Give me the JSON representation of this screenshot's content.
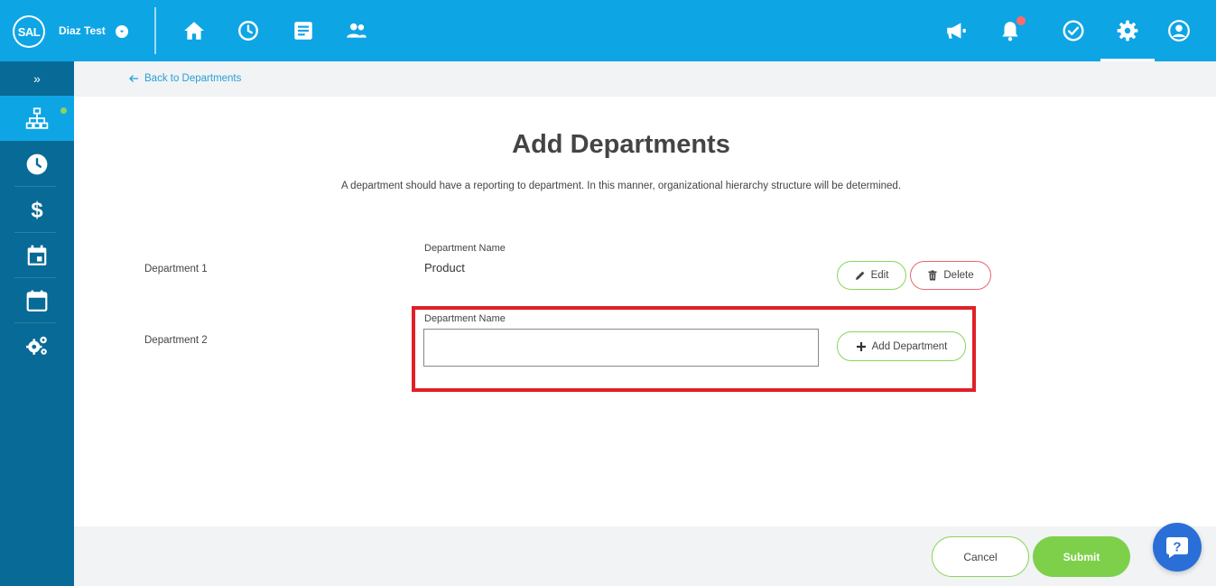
{
  "header": {
    "logo_text": "SAL",
    "company_name": "Diaz Test",
    "icons": [
      "home-icon",
      "clock-icon",
      "document-icon",
      "people-icon",
      "megaphone-icon",
      "bell-icon",
      "check-circle-icon",
      "gear-icon",
      "user-icon"
    ]
  },
  "sidebar": {
    "expand_label": "»",
    "items": [
      "org-chart-icon",
      "clock-icon",
      "dollar-icon",
      "calendar-icon",
      "calendar-blank-icon",
      "gears-icon"
    ]
  },
  "breadcrumb": {
    "back_label": "Back to Departments"
  },
  "page": {
    "title": "Add Departments",
    "subtitle": "A department should have a reporting to department. In this manner, organizational hierarchy structure will be determined."
  },
  "departments": [
    {
      "label": "Department 1",
      "field_label": "Department Name",
      "value": "Product",
      "edit_label": "Edit",
      "delete_label": "Delete"
    },
    {
      "label": "Department 2",
      "field_label": "Department Name",
      "input_value": "",
      "add_label": "Add Department"
    }
  ],
  "footer": {
    "cancel_label": "Cancel",
    "submit_label": "Submit"
  },
  "colors": {
    "primary": "#0ea5e5",
    "sidebar": "#086a96",
    "accent_green": "#7ed04b",
    "danger": "#e5666f",
    "highlight": "#e02127"
  }
}
